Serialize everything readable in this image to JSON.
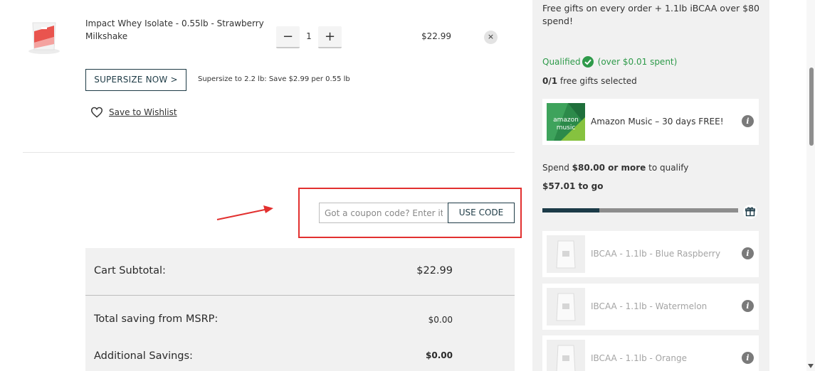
{
  "cart_item": {
    "title": "Impact Whey Isolate - 0.55lb - Strawberry Milkshake",
    "quantity": "1",
    "minus_label": "−",
    "plus_label": "+",
    "price": "$22.99",
    "remove_label": "×",
    "supersize_button": "SUPERSIZE NOW >",
    "supersize_note": "Supersize to 2.2 lb: Save $2.99 per 0.55 lb",
    "wishlist_label": "Save to Wishlist",
    "icons": {
      "remove": "close-icon",
      "wishlist": "heart-icon"
    }
  },
  "coupon": {
    "placeholder": "Got a coupon code? Enter it here",
    "button": "USE CODE"
  },
  "totals": {
    "subtotal_label": "Cart Subtotal:",
    "subtotal_value": "$22.99",
    "msrp_label": "Total saving from MSRP:",
    "msrp_value": "$0.00",
    "additional_label": "Additional Savings:",
    "additional_value": "$0.00"
  },
  "sidebar": {
    "intro": "Free gifts on every order + 1.1lb iBCAA over $80 spend!",
    "qualified": "Qualified",
    "qualified_note": "(over $0.01 spent)",
    "gift_count": "0/1",
    "gift_count_suffix": " free gifts selected",
    "amazon_gift": "Amazon Music – 30 days FREE!",
    "amazon_logo_line1": "amazon",
    "amazon_logo_line2": "music",
    "spend_prefix": "Spend ",
    "spend_amount": "$80.00 or more",
    "spend_suffix": " to qualify",
    "to_go": "$57.01 to go",
    "progress": 0.29,
    "gifts": [
      {
        "name": "IBCAA - 1.1lb - Blue Raspberry"
      },
      {
        "name": "IBCAA - 1.1lb - Watermelon"
      },
      {
        "name": "IBCAA - 1.1lb - Orange"
      }
    ],
    "info_label": "i",
    "icons": {
      "info": "info-icon",
      "gift": "gift-icon",
      "check": "check-circle-icon"
    }
  },
  "colors": {
    "accent": "#1e3b46",
    "success": "#2e9a4a",
    "highlight": "#e2302f",
    "sidebar_bg": "#f1f1f1"
  }
}
